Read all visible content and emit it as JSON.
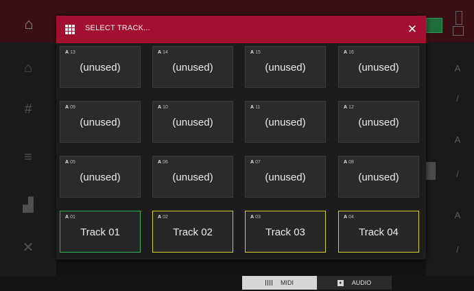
{
  "modal": {
    "title": "SELECT TRACK...",
    "close_label": "✕",
    "tracks": [
      {
        "bank": "A",
        "number": "13",
        "name": "(unused)",
        "state": "normal"
      },
      {
        "bank": "A",
        "number": "14",
        "name": "(unused)",
        "state": "normal"
      },
      {
        "bank": "A",
        "number": "15",
        "name": "(unused)",
        "state": "normal"
      },
      {
        "bank": "A",
        "number": "16",
        "name": "(unused)",
        "state": "normal"
      },
      {
        "bank": "A",
        "number": "09",
        "name": "(unused)",
        "state": "normal"
      },
      {
        "bank": "A",
        "number": "10",
        "name": "(unused)",
        "state": "normal"
      },
      {
        "bank": "A",
        "number": "11",
        "name": "(unused)",
        "state": "normal"
      },
      {
        "bank": "A",
        "number": "12",
        "name": "(unused)",
        "state": "normal"
      },
      {
        "bank": "A",
        "number": "05",
        "name": "(unused)",
        "state": "normal"
      },
      {
        "bank": "A",
        "number": "06",
        "name": "(unused)",
        "state": "normal"
      },
      {
        "bank": "A",
        "number": "07",
        "name": "(unused)",
        "state": "normal"
      },
      {
        "bank": "A",
        "number": "08",
        "name": "(unused)",
        "state": "normal"
      },
      {
        "bank": "A",
        "number": "01",
        "name": "Track 01",
        "state": "selected"
      },
      {
        "bank": "A",
        "number": "02",
        "name": "Track 02",
        "state": "highlighted"
      },
      {
        "bank": "A",
        "number": "03",
        "name": "Track 03",
        "state": "highlighted"
      },
      {
        "bank": "A",
        "number": "04",
        "name": "Track 04",
        "state": "highlighted"
      }
    ]
  },
  "type_toggle": {
    "midi_label": "MIDI",
    "audio_label": "AUDIO",
    "active": "MIDI"
  },
  "colors": {
    "header": "#a30f2e",
    "selected_border": "#2fb45a",
    "highlight_border": "#d9d21c"
  },
  "icons": {
    "header": "grid-icon",
    "close": "close-icon",
    "midi": "midi-icon",
    "audio": "audio-icon"
  }
}
